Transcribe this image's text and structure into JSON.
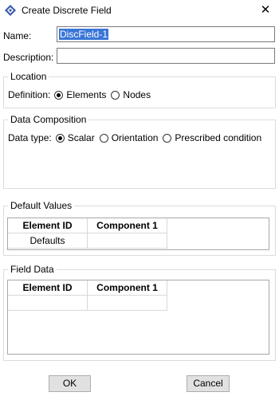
{
  "window": {
    "title": "Create Discrete Field"
  },
  "form": {
    "name_label": "Name:",
    "name_value": "DiscField-1",
    "description_label": "Description:",
    "description_value": ""
  },
  "location": {
    "legend": "Location",
    "definition_label": "Definition:",
    "options": [
      "Elements",
      "Nodes"
    ],
    "selected": "Elements"
  },
  "data_composition": {
    "legend": "Data Composition",
    "data_type_label": "Data type:",
    "options": [
      "Scalar",
      "Orientation",
      "Prescribed condition"
    ],
    "selected": "Scalar"
  },
  "default_values": {
    "legend": "Default Values",
    "columns": [
      "Element ID",
      "Component 1"
    ],
    "rows": [
      [
        "Defaults",
        ""
      ]
    ]
  },
  "field_data": {
    "legend": "Field Data",
    "columns": [
      "Element ID",
      "Component 1"
    ],
    "rows": [
      [
        "",
        ""
      ]
    ]
  },
  "buttons": {
    "ok": "OK",
    "cancel": "Cancel"
  }
}
